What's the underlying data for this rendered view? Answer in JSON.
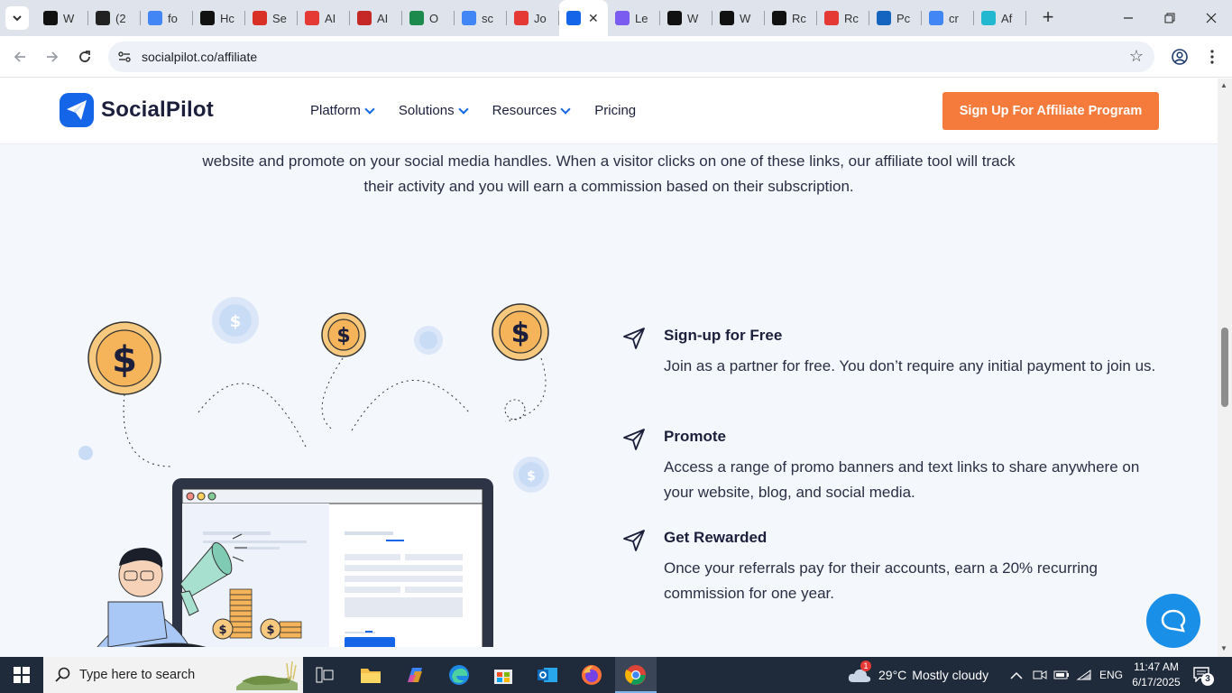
{
  "browser": {
    "tabs": [
      {
        "label": "W",
        "icon": "openai",
        "color": "#111111"
      },
      {
        "label": "(2",
        "icon": "b-bubble",
        "color": "#222222"
      },
      {
        "label": "fo",
        "icon": "google",
        "color": "#4285f4"
      },
      {
        "label": "Hc",
        "icon": "bi",
        "color": "#111111"
      },
      {
        "label": "Se",
        "icon": "x-red",
        "color": "#d93025"
      },
      {
        "label": "AI",
        "icon": "sgt",
        "color": "#e53935"
      },
      {
        "label": "AI",
        "icon": "fx",
        "color": "#c62828"
      },
      {
        "label": "O",
        "icon": "dollar-green",
        "color": "#1b8a4c"
      },
      {
        "label": "sc",
        "icon": "google",
        "color": "#4285f4"
      },
      {
        "label": "Jo",
        "icon": "owl",
        "color": "#e53935"
      },
      {
        "label": "",
        "icon": "socialpilot",
        "color": "#1565e8",
        "active": true
      },
      {
        "label": "Le",
        "icon": "person-purple",
        "color": "#7b5cf0"
      },
      {
        "label": "W",
        "icon": "a-letter",
        "color": "#111111"
      },
      {
        "label": "W",
        "icon": "cat",
        "color": "#111111"
      },
      {
        "label": "Rc",
        "icon": "a-letter",
        "color": "#111111"
      },
      {
        "label": "Rc",
        "icon": "rocket",
        "color": "#e53935"
      },
      {
        "label": "Pc",
        "icon": "xf",
        "color": "#1565c0"
      },
      {
        "label": "cr",
        "icon": "google",
        "color": "#4285f4"
      },
      {
        "label": "Af",
        "icon": "socialpilot-outline",
        "color": "#22b8cf"
      }
    ],
    "close_tab_symbol": "✕",
    "new_tab_symbol": "+",
    "url": "socialpilot.co/affiliate"
  },
  "site": {
    "brand": "SocialPilot",
    "nav": [
      {
        "label": "Platform",
        "has_dropdown": true
      },
      {
        "label": "Solutions",
        "has_dropdown": true
      },
      {
        "label": "Resources",
        "has_dropdown": true
      },
      {
        "label": "Pricing",
        "has_dropdown": false
      }
    ],
    "cta_label": "Sign Up For Affiliate Program",
    "brand_color": "#1565e8",
    "cta_color": "#f57b3c",
    "intro_lines": [
      "website and promote on your social media handles. When a visitor clicks on one of these links, our affiliate tool will track",
      "their activity and you will earn a commission based on their subscription."
    ],
    "steps": [
      {
        "title": "Sign-up for Free",
        "description": "Join as a partner for free. You don’t require any initial payment to join us."
      },
      {
        "title": "Promote",
        "description": "Access a range of promo banners and text links to share anywhere on your website, blog, and social media."
      },
      {
        "title": "Get Rewarded",
        "description": "Once your referrals pay for their accounts, earn a 20% recurring commission for one year."
      }
    ],
    "illustration": {
      "coin_symbol": "$"
    }
  },
  "taskbar": {
    "search_placeholder": "Type here to search",
    "weather_temp": "29°C",
    "weather_desc": "Mostly cloudy",
    "weather_badge": "1",
    "language": "ENG",
    "time": "11:47 AM",
    "date": "6/17/2025",
    "notification_count": "3"
  }
}
